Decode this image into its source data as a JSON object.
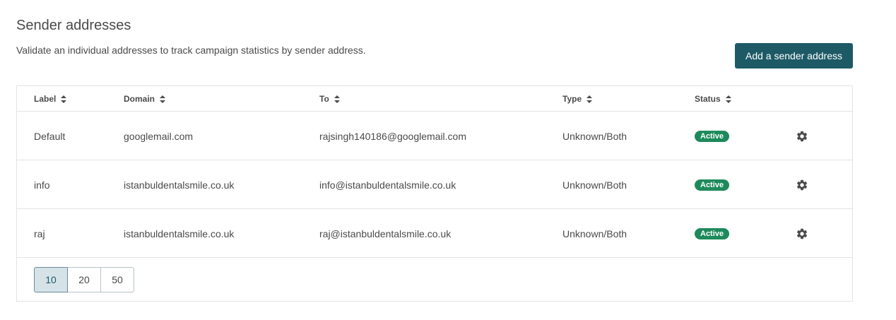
{
  "page": {
    "title": "Sender addresses",
    "description": "Validate an individual addresses to track campaign statistics by sender address.",
    "add_button": "Add a sender address"
  },
  "table": {
    "columns": [
      "Label",
      "Domain",
      "To",
      "Type",
      "Status"
    ],
    "rows": [
      {
        "label": "Default",
        "domain": "googlemail.com",
        "to": "rajsingh140186@googlemail.com",
        "type": "Unknown/Both",
        "status": "Active"
      },
      {
        "label": "info",
        "domain": "istanbuldentalsmile.co.uk",
        "to": "info@istanbuldentalsmile.co.uk",
        "type": "Unknown/Both",
        "status": "Active"
      },
      {
        "label": "raj",
        "domain": "istanbuldentalsmile.co.uk",
        "to": "raj@istanbuldentalsmile.co.uk",
        "type": "Unknown/Both",
        "status": "Active"
      }
    ],
    "row_action_icon": "gear-icon",
    "sort_icon": "sort-icon"
  },
  "pagination": {
    "options": [
      "10",
      "20",
      "50"
    ],
    "selected": "10"
  },
  "colors": {
    "primary": "#1d5a66",
    "active_badge": "#1e8a5c",
    "selected_page": "#d5e3e8"
  }
}
